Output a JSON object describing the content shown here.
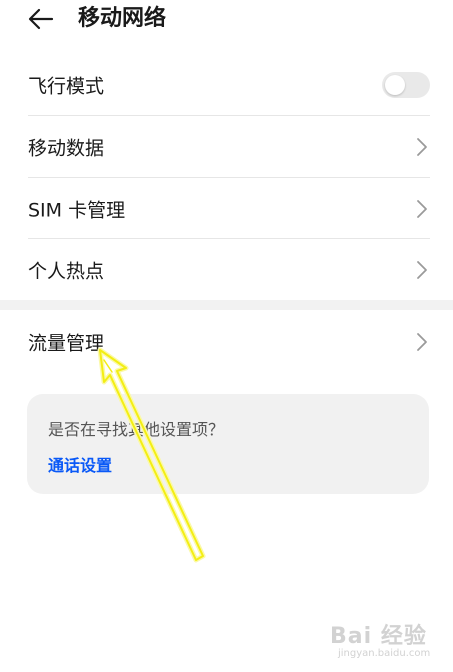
{
  "header": {
    "title": "移动网络"
  },
  "settings": [
    {
      "label": "飞行模式",
      "control": "toggle",
      "toggle_on": false
    },
    {
      "label": "移动数据",
      "control": "chevron"
    },
    {
      "label": "SIM 卡管理",
      "control": "chevron"
    },
    {
      "label": "个人热点",
      "control": "chevron"
    },
    {
      "label": "流量管理",
      "control": "chevron"
    }
  ],
  "suggestion": {
    "question": "是否在寻找其他设置项？",
    "link": "通话设置"
  },
  "watermark": {
    "logo": "Bai 经验",
    "url": "jingyan.baidu.com"
  },
  "colors": {
    "link": "#0a59f7",
    "annotation_arrow": "#f5f21a",
    "toggle_off": "#e9e9e9",
    "card_bg": "#f1f1f1"
  }
}
